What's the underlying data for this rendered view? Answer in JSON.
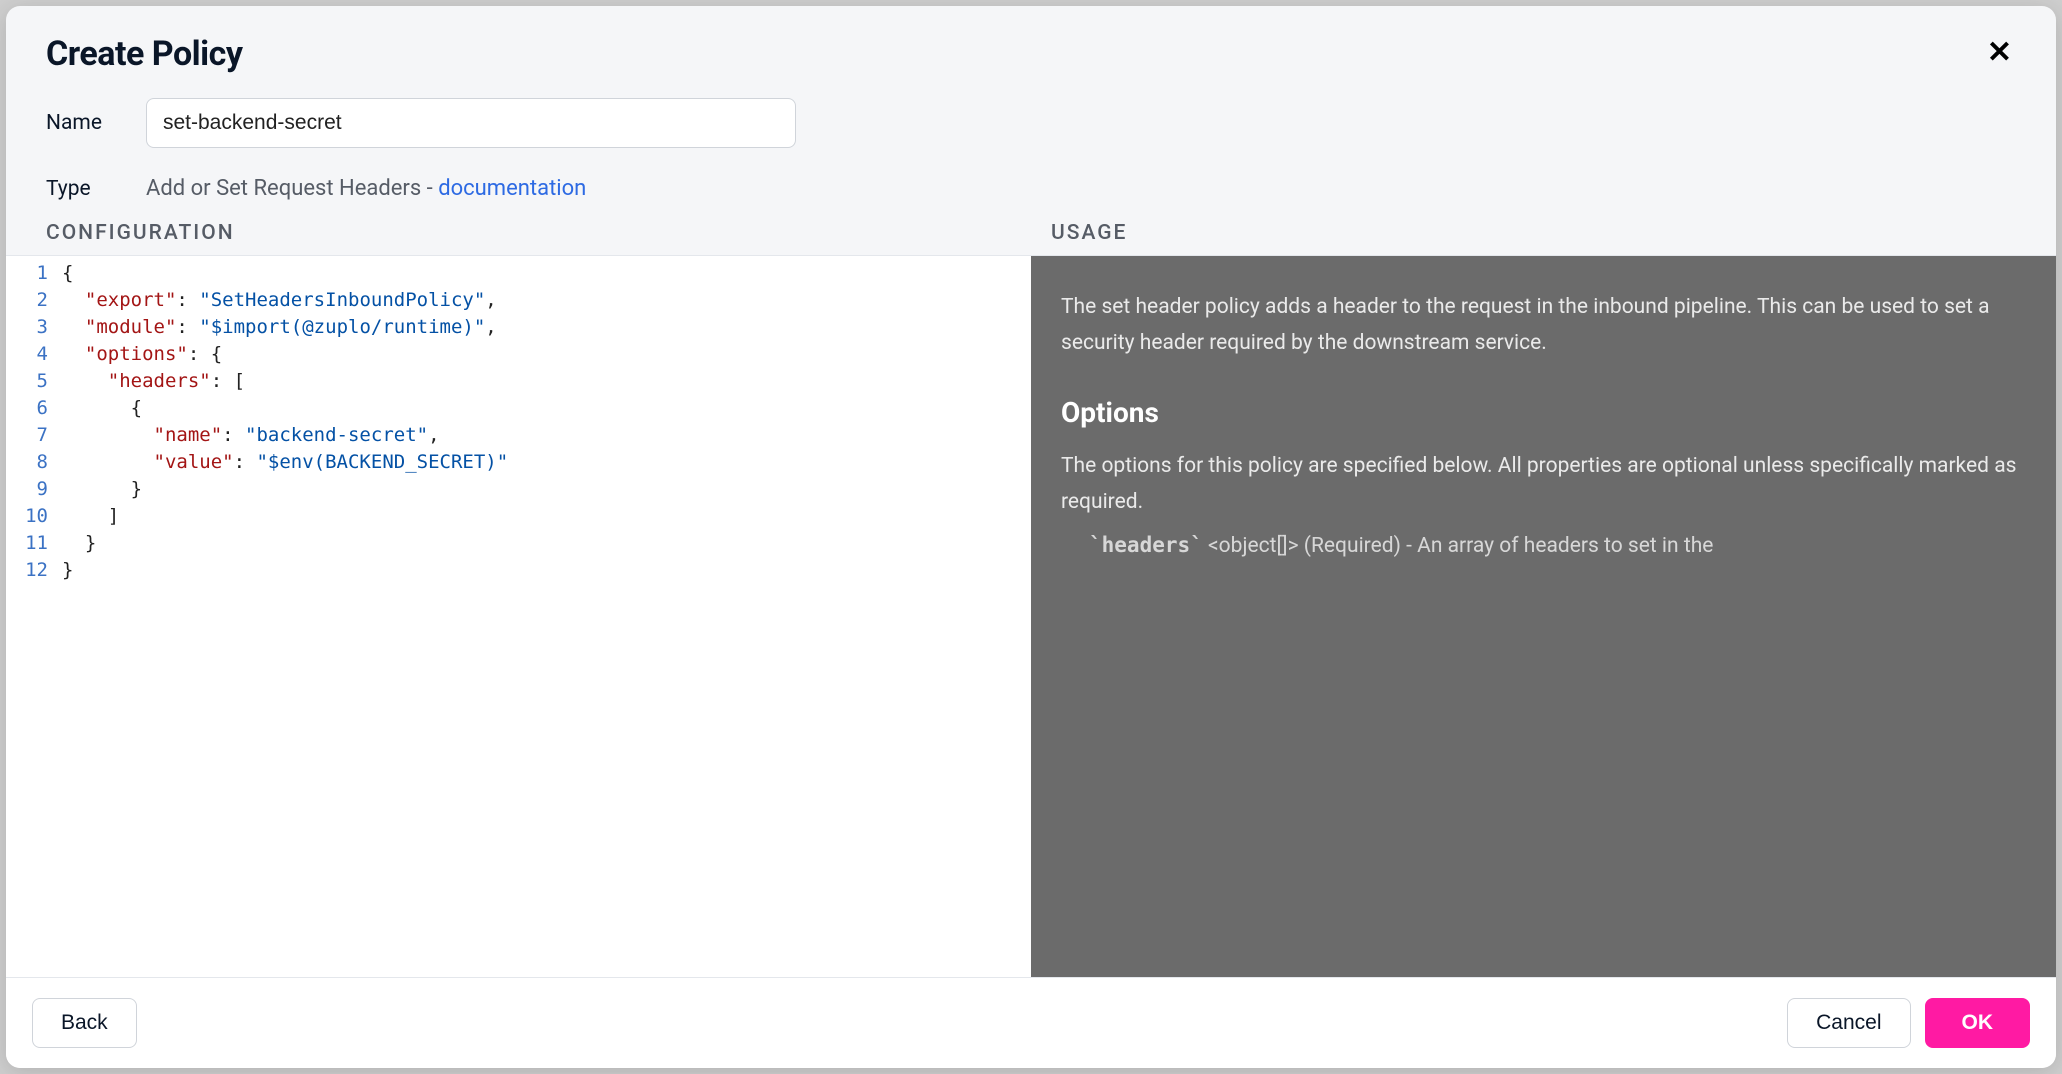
{
  "modal": {
    "title": "Create Policy",
    "close_icon": "✕"
  },
  "form": {
    "name_label": "Name",
    "name_value": "set-backend-secret",
    "type_label": "Type",
    "type_value_prefix": "Add or Set Request Headers - ",
    "type_doc_link": "documentation"
  },
  "sections": {
    "configuration": "CONFIGURATION",
    "usage": "USAGE"
  },
  "editor": {
    "line_numbers": [
      "1",
      "2",
      "3",
      "4",
      "5",
      "6",
      "7",
      "8",
      "9",
      "10",
      "11",
      "12"
    ],
    "config_json": {
      "export": "SetHeadersInboundPolicy",
      "module": "$import(@zuplo/runtime)",
      "options": {
        "headers": [
          {
            "name": "backend-secret",
            "value": "$env(BACKEND_SECRET)"
          }
        ]
      }
    }
  },
  "usage": {
    "intro": "The set header policy adds a header to the request in the inbound pipeline. This can be used to set a security header required by the downstream service.",
    "options_heading": "Options",
    "options_intro": "The options for this policy are specified below. All properties are optional unless specifically marked as required.",
    "headers_item_code": "`headers`",
    "headers_item_rest": " <object[]> (Required) - An array of headers to set in the"
  },
  "footer": {
    "back": "Back",
    "cancel": "Cancel",
    "ok": "OK"
  }
}
